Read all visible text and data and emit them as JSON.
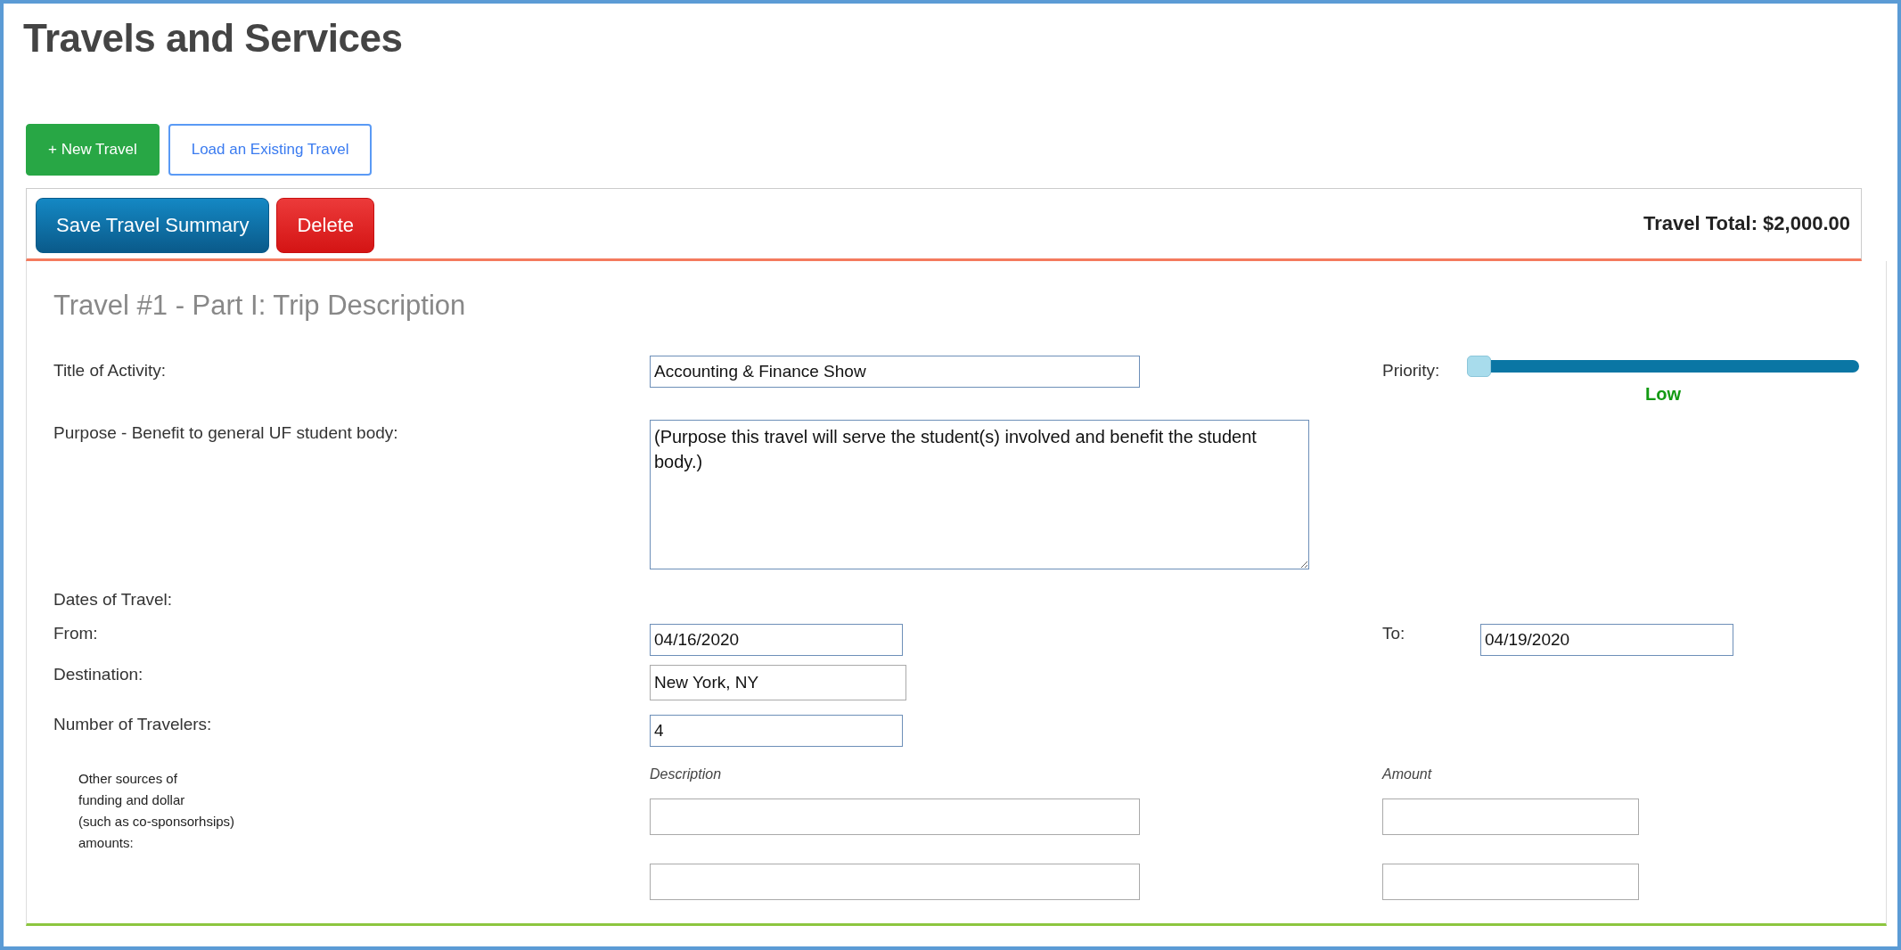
{
  "page": {
    "title": "Travels and Services"
  },
  "toolbar": {
    "buttons": [
      {
        "label": "+ New Travel",
        "kind": "success"
      },
      {
        "label": "Load an Existing Travel",
        "kind": "outline"
      }
    ]
  },
  "summary_bar": {
    "buttons": [
      {
        "label": "Save Travel Summary",
        "kind": "save"
      },
      {
        "label": "Delete",
        "kind": "danger"
      }
    ],
    "total": "Travel Total: $2,000.00"
  },
  "form": {
    "heading": "Travel #1 - Part I: Trip Description",
    "title_of_activity": {
      "label": "Title of Activity:",
      "value": "Accounting & Finance Show"
    },
    "priority": {
      "label": "Priority:",
      "level": 0,
      "reading": "Low"
    },
    "purpose": {
      "label": "Purpose - Benefit to general UF student body:",
      "value": "(Purpose this travel will serve the student(s) involved and benefit the student body.)"
    },
    "dates": {
      "label": "Dates of Travel:",
      "from": {
        "label": "From:",
        "value": "04/16/2020"
      },
      "to": {
        "label": "To:",
        "value": "04/19/2020"
      }
    },
    "destination": {
      "label": "Destination:",
      "value": "New York, NY"
    },
    "travelers": {
      "label": "Number of Travelers:",
      "value": "4"
    },
    "funding": {
      "label_lines": [
        "Other sources of",
        "funding and dollar",
        "(such as co-sponsorhsips)",
        "amounts:"
      ],
      "columns": [
        "Description",
        "Amount"
      ],
      "rows": [
        {
          "kind": "entry"
        },
        {
          "kind": "entry"
        }
      ]
    }
  }
}
